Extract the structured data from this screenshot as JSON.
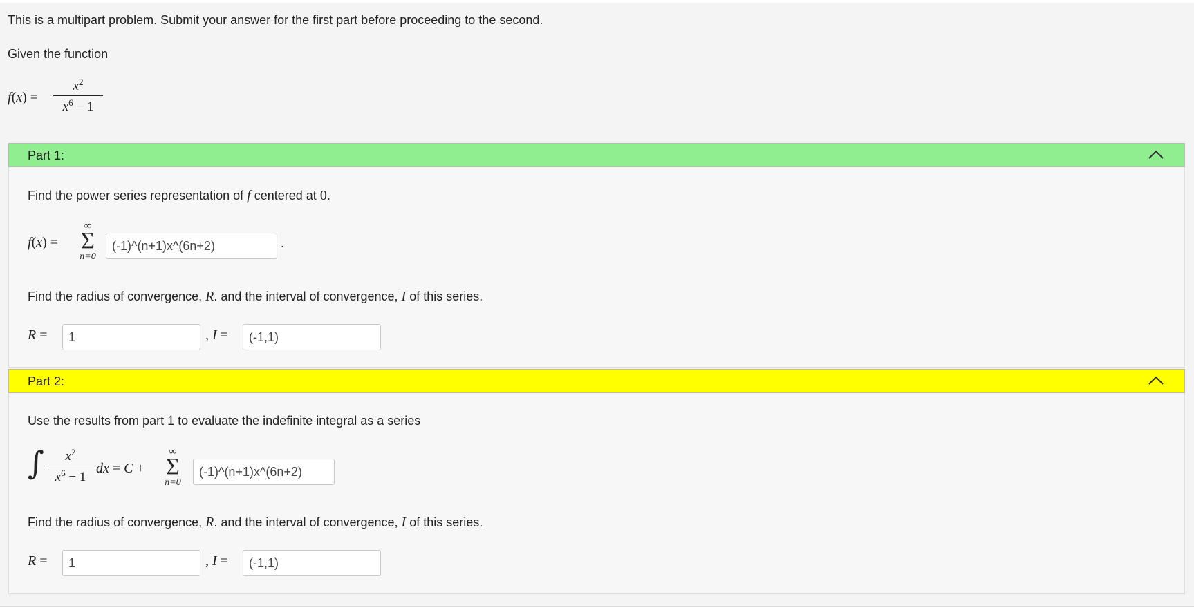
{
  "intro": "This is a multipart problem. Submit your answer for the first part before proceeding to the second.",
  "given": "Given the function",
  "function": {
    "lhs": "f(x) =",
    "numerator_base": "x",
    "numerator_exp": "2",
    "denominator_base": "x",
    "denominator_exp": "6",
    "denominator_rest": " − 1"
  },
  "colors": {
    "part1_header": "#90ee90",
    "part2_header": "#ffff00"
  },
  "part1": {
    "header": "Part 1:",
    "chevron_icon": "chevron-up-icon",
    "q1_prefix": "Find the power series representation of ",
    "q1_var": "f",
    "q1_mid": " centered at ",
    "q1_zero": "0",
    "q1_end": ".",
    "series_lhs": "f(x) =",
    "sigma_top": "∞",
    "sigma_symbol": "Σ",
    "sigma_bottom": "n=0",
    "series_value": "(-1)^(n+1)x^(6n+2)",
    "series_period": ".",
    "q2_prefix": "Find the radius of convergence, ",
    "q2_R": "R",
    "q2_mid": ". and the interval of convergence, ",
    "q2_I": "I",
    "q2_end": " of this series.",
    "R_label": "R =",
    "R_value": "1",
    "I_label": ", I =",
    "I_value": "(-1,1)"
  },
  "part2": {
    "header": "Part 2:",
    "chevron_icon": "chevron-up-icon",
    "q1": "Use the results from part 1 to evaluate the indefinite integral as a series",
    "integral_symbol": "∫",
    "int_num_base": "x",
    "int_num_exp": "2",
    "int_den_base": "x",
    "int_den_exp": "6",
    "int_den_rest": " − 1",
    "int_rhs_dx": "dx",
    "int_rhs_eq": " = ",
    "int_rhs_C": "C",
    "int_rhs_plus": " +",
    "sigma_top": "∞",
    "sigma_symbol": "Σ",
    "sigma_bottom": "n=0",
    "series_value": "(-1)^(n+1)x^(6n+2)",
    "q2_prefix": "Find the radius of convergence, ",
    "q2_R": "R",
    "q2_mid": ". and the interval of convergence, ",
    "q2_I": "I",
    "q2_end": " of this series.",
    "R_label": "R =",
    "R_value": "1",
    "I_label": ", I =",
    "I_value": "(-1,1)"
  }
}
